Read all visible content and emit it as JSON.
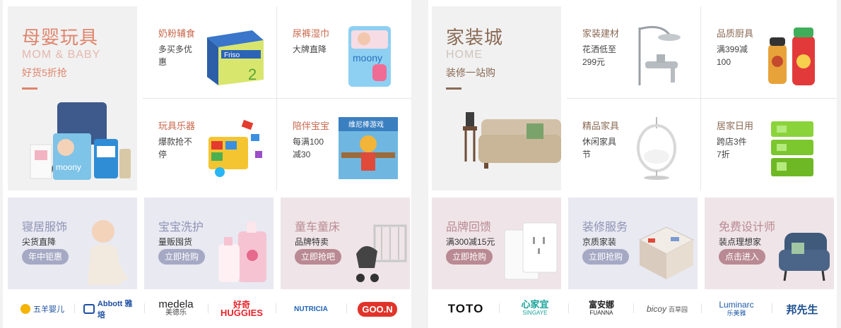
{
  "left": {
    "hero": {
      "title": "母婴玩具",
      "subtitle_en": "MOM & BABY",
      "tagline": "好货5折抢",
      "title_color": "#e0846c"
    },
    "cells": [
      {
        "title": "奶粉辅食",
        "desc_line1": "多买多优",
        "desc_line2": "惠",
        "icon": "milk-powder-can-icon"
      },
      {
        "title": "尿裤湿巾",
        "desc_line1": "大牌直降",
        "desc_line2": "",
        "icon": "diaper-pack-icon"
      },
      {
        "title": "玩具乐器",
        "desc_line1": "爆款抢不",
        "desc_line2": "停",
        "icon": "building-blocks-icon"
      },
      {
        "title": "陪伴宝宝",
        "desc_line1": "每满100",
        "desc_line2": "减30",
        "icon": "picture-book-icon",
        "book_title": "维尼棒游戏"
      }
    ],
    "promos": [
      {
        "title": "寝居服饰",
        "sub": "尖货直降",
        "button": "年中钜惠",
        "bg": "#e8e9f1",
        "btn_color": "#a5a9c4",
        "title_color": "#8e93b5"
      },
      {
        "title": "宝宝洗护",
        "sub": "量贩囤货",
        "button": "立即抢购",
        "bg": "#e8e9f1",
        "btn_color": "#a5a9c4",
        "title_color": "#8e93b5"
      },
      {
        "title": "童车童床",
        "sub": "品牌特卖",
        "button": "立即抢吧",
        "bg": "#efe4e7",
        "btn_color": "#b98a93",
        "title_color": "#b98a93"
      }
    ],
    "brands": [
      {
        "name": "五羊婴儿",
        "icon": "wuyang-logo"
      },
      {
        "name": "Abbott 雅培",
        "icon": "abbott-logo"
      },
      {
        "name": "medela",
        "name2": "美德乐",
        "icon": "medela-logo"
      },
      {
        "name": "好奇",
        "name2": "HUGGIES",
        "icon": "huggies-logo"
      },
      {
        "name": "NUTRICIA",
        "icon": "nutricia-logo"
      },
      {
        "name": "GOO.N",
        "icon": "goon-logo"
      }
    ]
  },
  "right": {
    "hero": {
      "title": "家装城",
      "subtitle_en": "HOME",
      "tagline": "装修一站购",
      "title_color": "#8a6a55"
    },
    "cells": [
      {
        "title": "家装建材",
        "desc_line1": "花洒低至",
        "desc_line2": "299元",
        "icon": "shower-faucet-icon"
      },
      {
        "title": "品质厨具",
        "desc_line1": "满399减",
        "desc_line2": "100",
        "icon": "thermos-icon"
      },
      {
        "title": "精品家具",
        "desc_line1": "休闲家具",
        "desc_line2": "节",
        "icon": "hanging-chair-icon"
      },
      {
        "title": "居家日用",
        "desc_line1": "跨店3件",
        "desc_line2": "7折",
        "icon": "storage-rack-icon"
      }
    ],
    "promos": [
      {
        "title": "品牌回馈",
        "sub": "满300减15元",
        "button": "立即抢购",
        "bg": "#efe4e7",
        "btn_color": "#b98a93",
        "title_color": "#b98a93"
      },
      {
        "title": "装修服务",
        "sub": "京质家装",
        "button": "立即抢购",
        "bg": "#e8e9f1",
        "btn_color": "#a5a9c4",
        "title_color": "#8e93b5"
      },
      {
        "title": "免费设计师",
        "sub": "装点理想家",
        "button": "点击进入",
        "bg": "#efe4e7",
        "btn_color": "#b98a93",
        "title_color": "#b98a93"
      }
    ],
    "brands": [
      {
        "name": "TOTO",
        "icon": "toto-logo"
      },
      {
        "name": "心家宜",
        "name2": "SINGAYE",
        "icon": "singaye-logo"
      },
      {
        "name": "富安娜",
        "name2": "FUANNA",
        "icon": "fuanna-logo"
      },
      {
        "name": "bicoy",
        "name2": "百草园",
        "icon": "bicoy-logo"
      },
      {
        "name": "Luminarc",
        "name2": "乐美雅",
        "icon": "luminarc-logo"
      },
      {
        "name": "邦先生",
        "icon": "bangxiansheng-logo"
      }
    ]
  },
  "colors": {
    "cell_title_left": "#c8664a",
    "cell_title_right": "#8a6a55",
    "dash": "#e0846c"
  }
}
